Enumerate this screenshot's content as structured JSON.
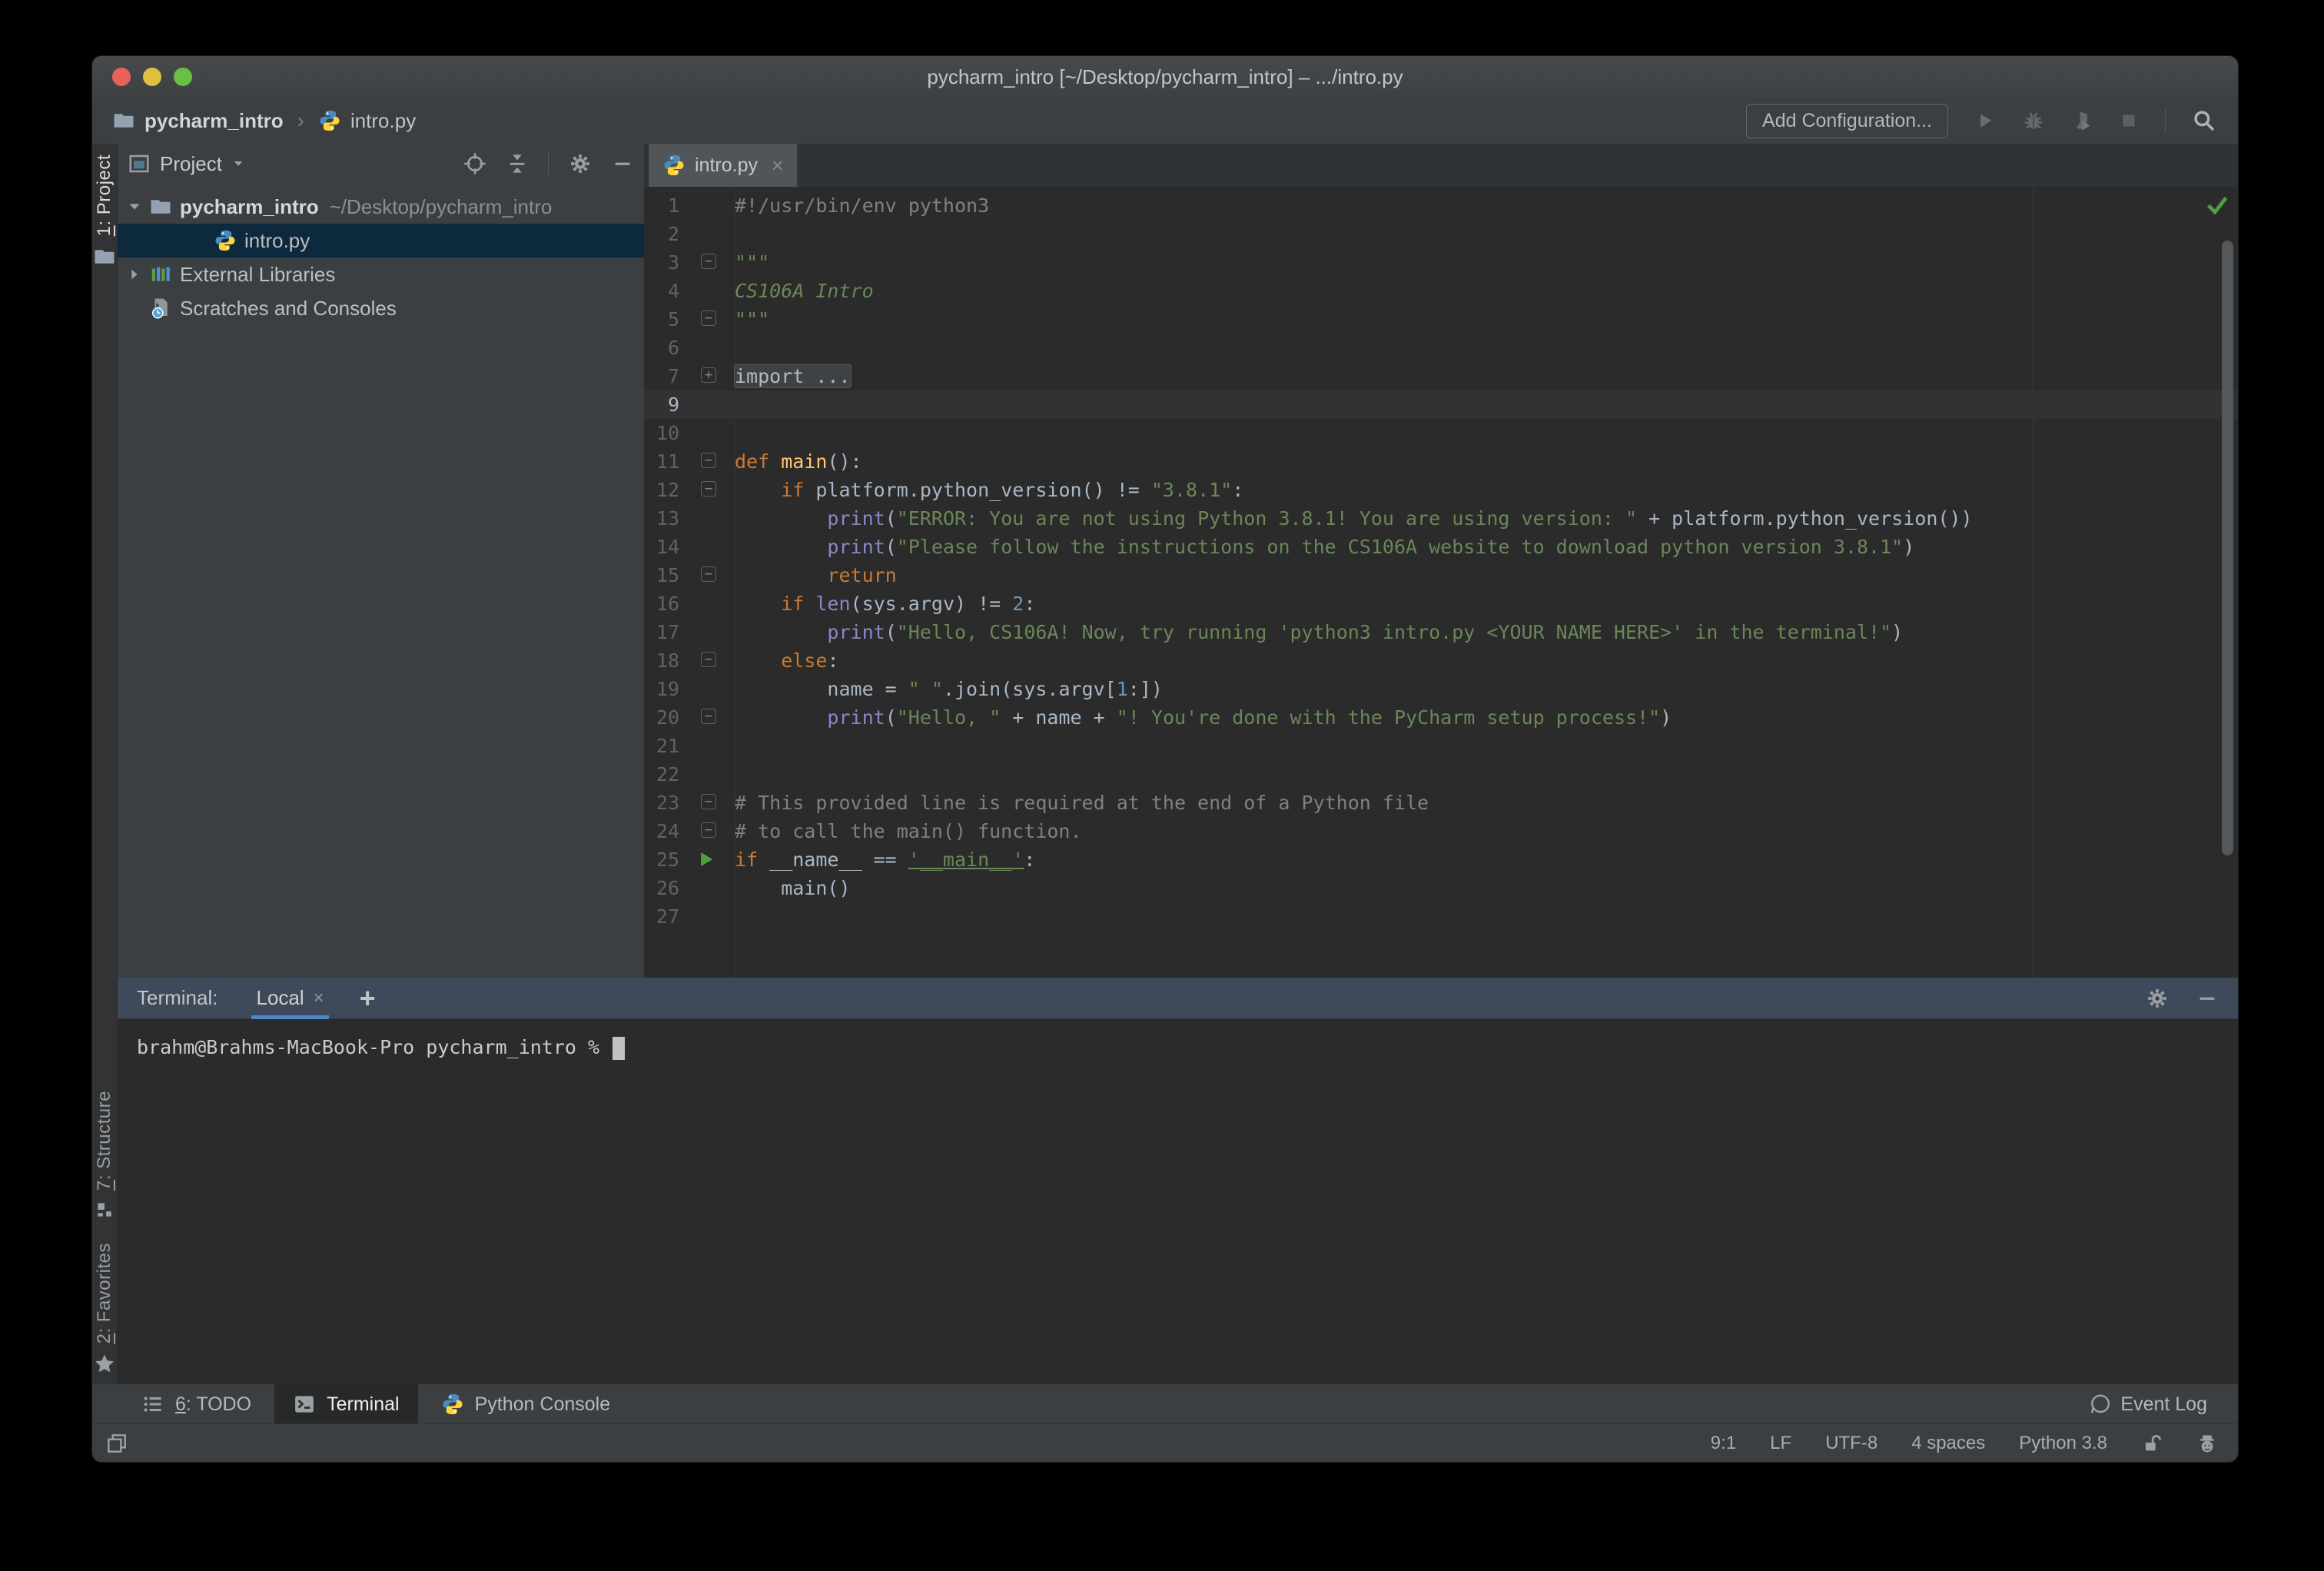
{
  "window": {
    "title": "pycharm_intro [~/Desktop/pycharm_intro] – .../intro.py"
  },
  "toolbar": {
    "breadcrumb": {
      "project": "pycharm_intro",
      "separator": "›",
      "file": "intro.py"
    },
    "add_configuration": "Add Configuration...",
    "icons": [
      "run",
      "debug",
      "coverage",
      "stop",
      "search"
    ]
  },
  "left_stripe": {
    "top": [
      {
        "label": "1: Project",
        "icon": "folder",
        "active": true
      }
    ],
    "bottom": [
      {
        "label": "7: Structure",
        "icon": "structure",
        "active": false
      },
      {
        "label": "2: Favorites",
        "icon": "star",
        "active": false
      }
    ]
  },
  "project_panel": {
    "header": {
      "title": "Project"
    },
    "tree": [
      {
        "label": "pycharm_intro",
        "path": "~/Desktop/pycharm_intro",
        "icon": "folder",
        "chevron": "down",
        "bold": true,
        "indent": 0,
        "selected": false
      },
      {
        "label": "intro.py",
        "path": "",
        "icon": "python",
        "chevron": "",
        "bold": false,
        "indent": 2,
        "selected": true
      },
      {
        "label": "External Libraries",
        "path": "",
        "icon": "libraries",
        "chevron": "right",
        "bold": false,
        "indent": 0,
        "selected": false
      },
      {
        "label": "Scratches and Consoles",
        "path": "",
        "icon": "scratches",
        "chevron": "",
        "bold": false,
        "indent": 0,
        "selected": false
      }
    ]
  },
  "editor": {
    "tab": {
      "label": "intro.py",
      "close": "×"
    },
    "lines": [
      {
        "n": "1",
        "t": [
          [
            "#!/usr/bin/env python3",
            "cm"
          ]
        ]
      },
      {
        "n": "2",
        "t": []
      },
      {
        "n": "3",
        "t": [
          [
            "\"\"\"",
            "st"
          ]
        ],
        "g": "minus"
      },
      {
        "n": "4",
        "t": [
          [
            "CS106A Intro",
            "sti"
          ]
        ]
      },
      {
        "n": "5",
        "t": [
          [
            "\"\"\"",
            "st"
          ]
        ],
        "g": "end"
      },
      {
        "n": "6",
        "t": []
      },
      {
        "n": "7",
        "t": [
          [
            "import ...",
            "fold"
          ]
        ],
        "g": "plus"
      },
      {
        "n": "9",
        "t": [],
        "caret": true
      },
      {
        "n": "10",
        "t": []
      },
      {
        "n": "11",
        "t": [
          [
            "def ",
            "kw"
          ],
          [
            "main",
            "fn"
          ],
          [
            "():",
            "tx"
          ]
        ],
        "g": "minus"
      },
      {
        "n": "12",
        "t": [
          [
            "    ",
            "tx"
          ],
          [
            "if ",
            "kw"
          ],
          [
            "platform.python_version() != ",
            "tx"
          ],
          [
            "\"3.8.1\"",
            "st"
          ],
          [
            ":",
            "tx"
          ]
        ],
        "g": "minus"
      },
      {
        "n": "13",
        "t": [
          [
            "        ",
            "tx"
          ],
          [
            "print",
            "bi"
          ],
          [
            "(",
            "tx"
          ],
          [
            "\"ERROR: You are not using Python 3.8.1! You are using version: \"",
            "st"
          ],
          [
            " + platform.python_version())",
            "tx"
          ]
        ]
      },
      {
        "n": "14",
        "t": [
          [
            "        ",
            "tx"
          ],
          [
            "print",
            "bi"
          ],
          [
            "(",
            "tx"
          ],
          [
            "\"Please follow the instructions on the CS106A website to download python version 3.8.1\"",
            "st"
          ],
          [
            ")",
            "tx"
          ]
        ]
      },
      {
        "n": "15",
        "t": [
          [
            "        ",
            "tx"
          ],
          [
            "return",
            "kw"
          ]
        ],
        "g": "end"
      },
      {
        "n": "16",
        "t": [
          [
            "    ",
            "tx"
          ],
          [
            "if ",
            "kw"
          ],
          [
            "len",
            "bi"
          ],
          [
            "(sys.argv) != ",
            "tx"
          ],
          [
            "2",
            "nu"
          ],
          [
            ":",
            "tx"
          ]
        ]
      },
      {
        "n": "17",
        "t": [
          [
            "        ",
            "tx"
          ],
          [
            "print",
            "bi"
          ],
          [
            "(",
            "tx"
          ],
          [
            "\"Hello, CS106A! Now, try running 'python3 intro.py <YOUR NAME HERE>' in the terminal!\"",
            "st"
          ],
          [
            ")",
            "tx"
          ]
        ]
      },
      {
        "n": "18",
        "t": [
          [
            "    ",
            "tx"
          ],
          [
            "else",
            "kw"
          ],
          [
            ":",
            "tx"
          ]
        ],
        "g": "minus"
      },
      {
        "n": "19",
        "t": [
          [
            "        name = ",
            "tx"
          ],
          [
            "\" \"",
            "st"
          ],
          [
            ".join(sys.argv[",
            "tx"
          ],
          [
            "1",
            "nu"
          ],
          [
            ":])",
            "tx"
          ]
        ]
      },
      {
        "n": "20",
        "t": [
          [
            "        ",
            "tx"
          ],
          [
            "print",
            "bi"
          ],
          [
            "(",
            "tx"
          ],
          [
            "\"Hello, \"",
            "st"
          ],
          [
            " + name + ",
            "tx"
          ],
          [
            "\"! You're done with the PyCharm setup process!\"",
            "st"
          ],
          [
            ")",
            "tx"
          ]
        ],
        "g": "end"
      },
      {
        "n": "21",
        "t": []
      },
      {
        "n": "22",
        "t": []
      },
      {
        "n": "23",
        "t": [
          [
            "# This provided line is required at the end of a Python file",
            "cm"
          ]
        ],
        "g": "minus"
      },
      {
        "n": "24",
        "t": [
          [
            "# to call the main() function.",
            "cm"
          ]
        ],
        "g": "end"
      },
      {
        "n": "25",
        "t": [
          [
            "if ",
            "kw"
          ],
          [
            "__name__ == ",
            "tx"
          ],
          [
            "'__main__'",
            "stu"
          ],
          [
            ":",
            "tx"
          ]
        ],
        "g": "run"
      },
      {
        "n": "26",
        "t": [
          [
            "    main()",
            "tx"
          ]
        ]
      },
      {
        "n": "27",
        "t": []
      }
    ]
  },
  "terminal": {
    "label": "Terminal:",
    "tab": "Local",
    "tab_close": "×",
    "new_tab": "+",
    "prompt": "brahm@Brahms-MacBook-Pro pycharm_intro % "
  },
  "bottom_bar": {
    "items": [
      {
        "label": "6: TODO",
        "icon": "todo",
        "active": false,
        "mnemonic": true
      },
      {
        "label": "Terminal",
        "icon": "terminal",
        "active": true,
        "mnemonic": false
      },
      {
        "label": "Python Console",
        "icon": "python",
        "active": false,
        "mnemonic": false
      }
    ],
    "event_log": "Event Log"
  },
  "status_bar": {
    "position": "9:1",
    "line_separator": "LF",
    "encoding": "UTF-8",
    "indent": "4 spaces",
    "interpreter": "Python 3.8"
  },
  "colors": {
    "accent_blue": "#4a88c7",
    "selection": "#0d293e",
    "editor_background": "#2b2b2b",
    "panel_background": "#3c3f41",
    "terminal_header": "#3e4a59",
    "keyword": "#cc7832",
    "string": "#6a8759",
    "comment": "#808080",
    "function_name": "#ffc66d",
    "builtin": "#8888c6",
    "number": "#6897bb",
    "run_green": "#4fa13f",
    "traffic_red": "#e8615a",
    "traffic_yellow": "#dfbe42",
    "traffic_green": "#6abf47"
  }
}
